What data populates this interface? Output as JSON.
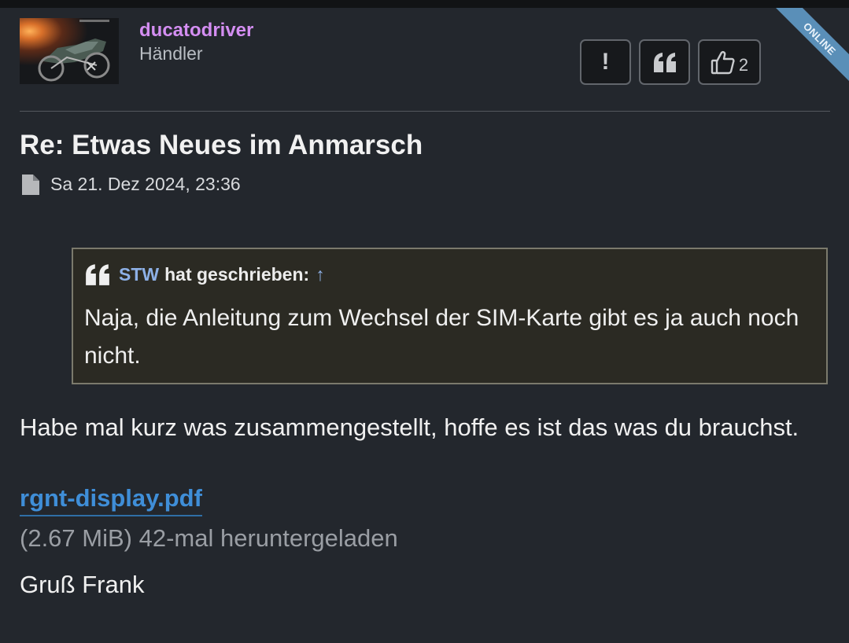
{
  "author": {
    "username": "ducatodriver",
    "rank": "Händler",
    "online_label": "ONLINE"
  },
  "actions": {
    "report_icon": "!",
    "quote_icon": "quote-icon",
    "like_count": "2"
  },
  "post": {
    "title": "Re: Etwas Neues im Anmarsch",
    "date": "Sa 21. Dez 2024, 23:36",
    "quote": {
      "author": "STW",
      "says": "hat geschrieben:",
      "arrow": "↑",
      "text": "Naja, die Anleitung zum Wechsel der SIM-Karte gibt es ja auch noch nicht."
    },
    "body": "Habe mal kurz was zusammengestellt, hoffe es ist das was du brauchst.",
    "attachment": {
      "name": "rgnt-display.pdf",
      "info": "(2.67 MiB) 42-mal heruntergeladen"
    },
    "signoff": "Gruß Frank"
  },
  "colors": {
    "background": "#23272d",
    "username": "#d48ef2",
    "link": "#3f8ed8",
    "quote_author": "#8db0e6",
    "online_ribbon": "#5a8fb8"
  }
}
